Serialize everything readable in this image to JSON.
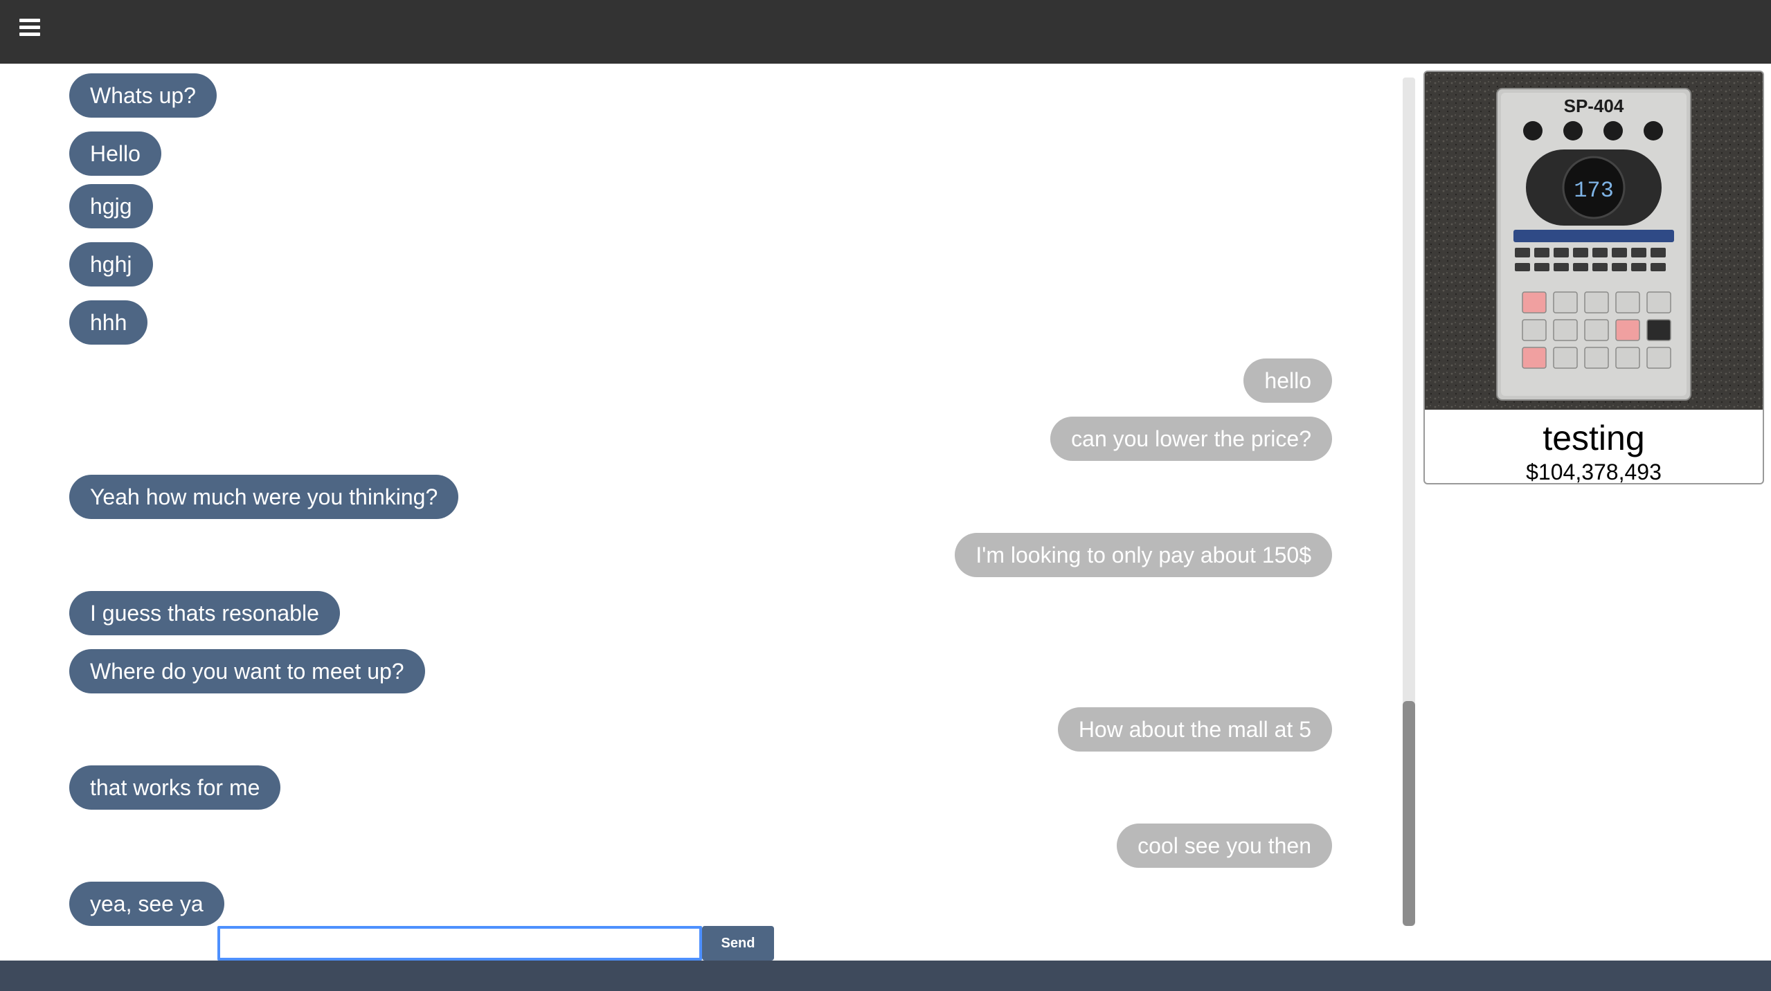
{
  "header": {
    "menu_icon": "hamburger-menu-icon"
  },
  "messages": [
    {
      "from": "them",
      "text": "Whats up?"
    },
    {
      "from": "them",
      "text": "Hello"
    },
    {
      "from": "them",
      "text": "hgjg"
    },
    {
      "from": "them",
      "text": "hghj"
    },
    {
      "from": "them",
      "text": "hhh"
    },
    {
      "from": "me",
      "text": "hello"
    },
    {
      "from": "me",
      "text": "can you lower the price?"
    },
    {
      "from": "them",
      "text": "Yeah how much were you thinking?"
    },
    {
      "from": "me",
      "text": "I'm looking to only pay about 150$"
    },
    {
      "from": "them",
      "text": "I guess thats resonable"
    },
    {
      "from": "them",
      "text": "Where do you want to meet up?"
    },
    {
      "from": "me",
      "text": "How about the mall at 5"
    },
    {
      "from": "them",
      "text": "that works for me"
    },
    {
      "from": "me",
      "text": "cool see you then"
    },
    {
      "from": "them",
      "text": "yea, see ya"
    }
  ],
  "composer": {
    "value": "",
    "send_label": "Send"
  },
  "listing": {
    "title": "testing",
    "price": "$104,378,493",
    "image_label": "SP-404",
    "display_value": "173"
  },
  "colors": {
    "their_bubble": "#4e6684",
    "my_bubble": "#b9b9b9",
    "topbar": "#333333",
    "bottombar": "#3e4a5c",
    "input_focus": "#4d90fe"
  }
}
